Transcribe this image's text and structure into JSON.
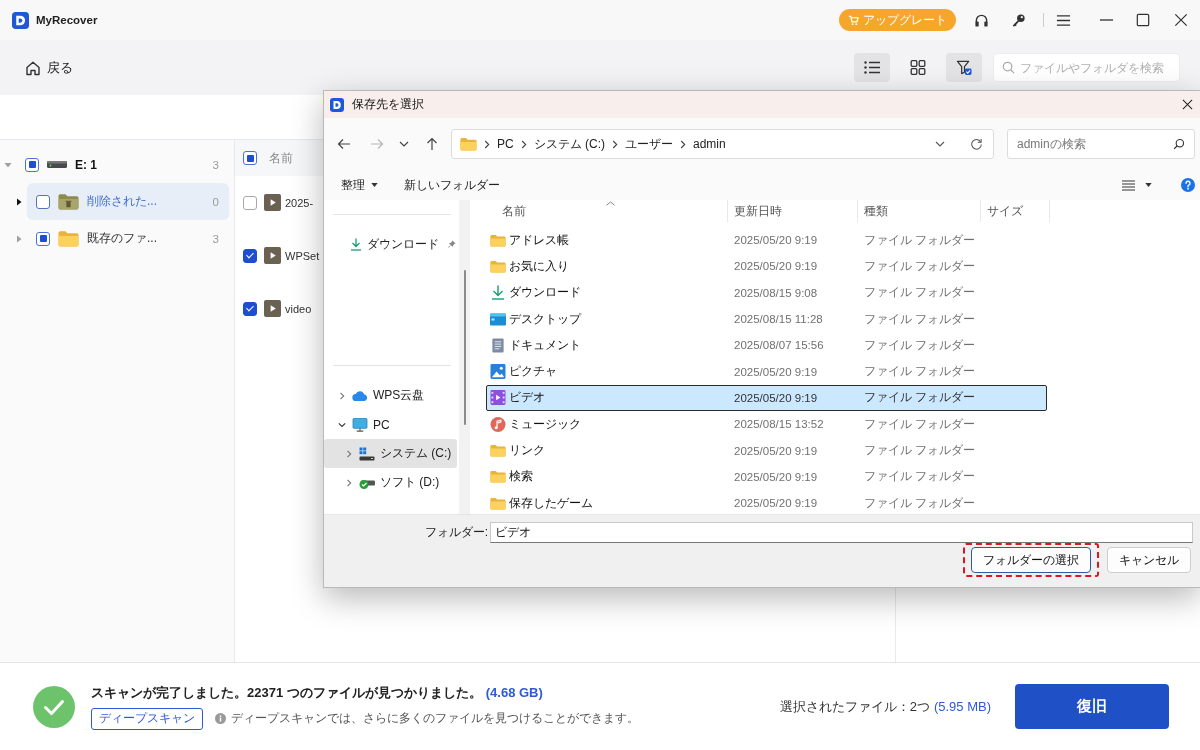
{
  "app": {
    "title": "MyRecover",
    "upgrade": "アップグレート"
  },
  "toolbar": {
    "back": "戻る",
    "views": [
      {
        "kind": "list",
        "selected": true
      },
      {
        "kind": "grid",
        "selected": false
      }
    ],
    "filter": {
      "active": true
    },
    "search": {
      "placeholder": "ファイルやフォルダを検索"
    }
  },
  "tree": [
    {
      "label": "E: 1",
      "count": "3",
      "kind": "drive",
      "checked": false,
      "partial": true,
      "expanded": true,
      "selected": false,
      "children": [
        {
          "label": "削除された...",
          "count": "0",
          "kind": "deleted",
          "checked": false,
          "partial": false,
          "expanded": false,
          "selected": true
        },
        {
          "label": "既存のファ...",
          "count": "3",
          "kind": "folder",
          "checked": false,
          "partial": true,
          "expanded": false,
          "selected": false
        }
      ]
    }
  ],
  "file_list": {
    "header": {
      "label": "名前",
      "checked": false,
      "partial": true
    },
    "rows": [
      {
        "name": "2025-",
        "checked": false
      },
      {
        "name": "WPSet",
        "checked": true
      },
      {
        "name": "video",
        "checked": true
      }
    ]
  },
  "dialog": {
    "title": "保存先を選択",
    "nav_buttons": [
      {
        "kind": "back",
        "disabled": false
      },
      {
        "kind": "forward",
        "disabled": true
      },
      {
        "kind": "recent",
        "disabled": false
      },
      {
        "kind": "up",
        "disabled": false
      }
    ],
    "path": [
      "PC",
      "システム (C:)",
      "ユーザー",
      "admin"
    ],
    "search": {
      "placeholder": "adminの検索"
    },
    "commands": [
      {
        "label": "整理",
        "kind": "menu"
      },
      {
        "label": "新しいフォルダー",
        "kind": "action"
      }
    ],
    "quick_access": [
      {
        "label": "ダウンロード",
        "kind": "download",
        "pinned": true
      }
    ],
    "nav_tree": [
      {
        "label": "WPS云盘",
        "kind": "cloud",
        "expanded": false,
        "selected": false
      },
      {
        "label": "PC",
        "kind": "pc",
        "expanded": true,
        "selected": false,
        "children": [
          {
            "label": "システム (C:)",
            "kind": "system",
            "expanded": false,
            "selected": true
          },
          {
            "label": "ソフト (D:)",
            "kind": "drive",
            "expanded": false,
            "selected": false
          }
        ]
      }
    ],
    "columns": [
      {
        "label": "名前",
        "sorted": true
      },
      {
        "label": "更新日時",
        "sorted": false
      },
      {
        "label": "種類",
        "sorted": false
      },
      {
        "label": "サイズ",
        "sorted": false
      }
    ],
    "rows": [
      {
        "name": "アドレス帳",
        "kind": "folder",
        "date": "2025/05/20 9:19",
        "type": "ファイル フォルダー",
        "selected": false
      },
      {
        "name": "お気に入り",
        "kind": "folder",
        "date": "2025/05/20 9:19",
        "type": "ファイル フォルダー",
        "selected": false
      },
      {
        "name": "ダウンロード",
        "kind": "download",
        "date": "2025/08/15 9:08",
        "type": "ファイル フォルダー",
        "selected": false
      },
      {
        "name": "デスクトップ",
        "kind": "desktop",
        "date": "2025/08/15 11:28",
        "type": "ファイル フォルダー",
        "selected": false
      },
      {
        "name": "ドキュメント",
        "kind": "document",
        "date": "2025/08/07 15:56",
        "type": "ファイル フォルダー",
        "selected": false
      },
      {
        "name": "ピクチャ",
        "kind": "picture",
        "date": "2025/05/20 9:19",
        "type": "ファイル フォルダー",
        "selected": false
      },
      {
        "name": "ビデオ",
        "kind": "video",
        "date": "2025/05/20 9:19",
        "type": "ファイル フォルダー",
        "selected": true
      },
      {
        "name": "ミュージック",
        "kind": "music",
        "date": "2025/08/15 13:52",
        "type": "ファイル フォルダー",
        "selected": false
      },
      {
        "name": "リンク",
        "kind": "folder",
        "date": "2025/05/20 9:19",
        "type": "ファイル フォルダー",
        "selected": false
      },
      {
        "name": "検索",
        "kind": "folder",
        "date": "2025/05/20 9:19",
        "type": "ファイル フォルダー",
        "selected": false
      },
      {
        "name": "保存したゲーム",
        "kind": "folder",
        "date": "2025/05/20 9:19",
        "type": "ファイル フォルダー",
        "selected": false
      }
    ],
    "folder": {
      "label": "フォルダー:",
      "value": "ビデオ"
    },
    "buttons": [
      {
        "label": "フォルダーの選択",
        "primary": true,
        "highlighted": true
      },
      {
        "label": "キャンセル",
        "primary": false,
        "highlighted": false
      }
    ]
  },
  "status_bar": {
    "message": "スキャンが完了しました。22371 つのファイルが見つかりました。",
    "total_size": "(4.68 GB)",
    "deep_scan": "ディープスキャン",
    "hint": "ディープスキャンでは、さらに多くのファイルを見つけることができます。",
    "selected_label": "選択されたファイル：2つ",
    "selected_size": "(5.95 MB)",
    "recover": "復旧"
  }
}
